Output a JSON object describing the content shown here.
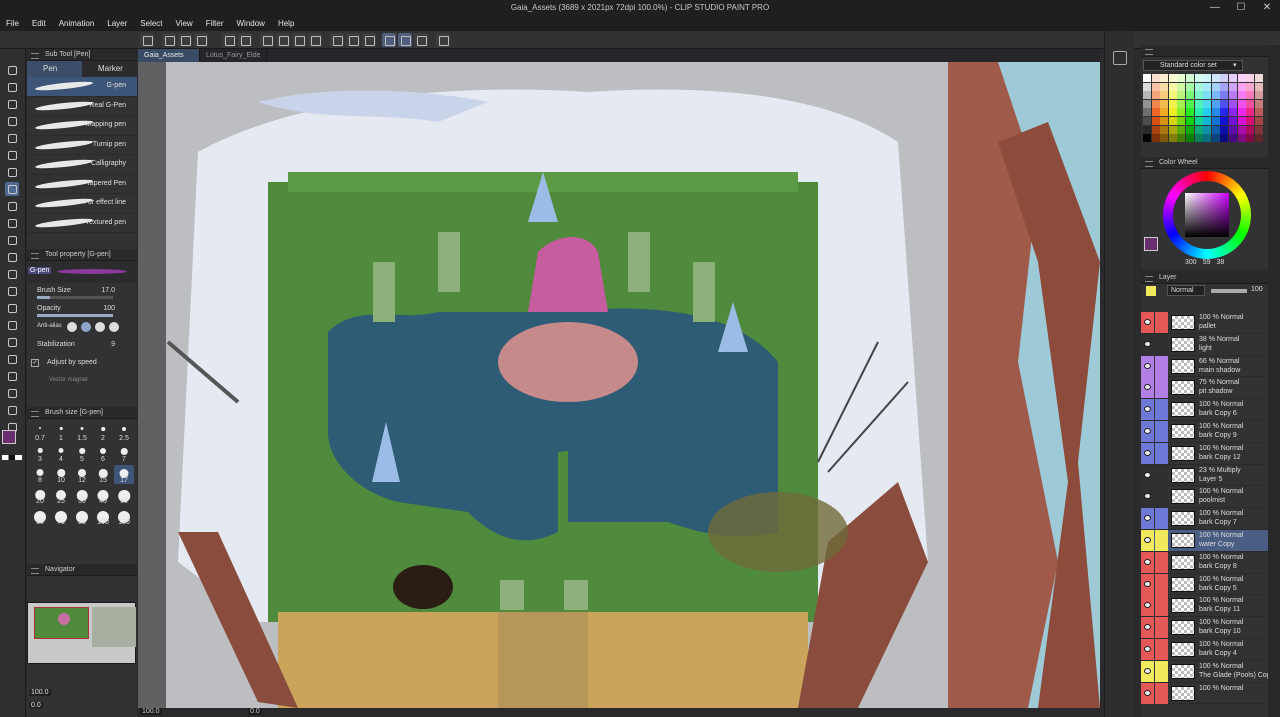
{
  "app": {
    "title": "Gaia_Assets (3689 x 2021px 72dpi 100.0%)  - CLIP STUDIO PAINT PRO"
  },
  "window_controls": {
    "minimize": "—",
    "maximize": "☐",
    "close": "✕"
  },
  "menu": [
    "File",
    "Edit",
    "Animation",
    "Layer",
    "Select",
    "View",
    "Filter",
    "Window",
    "Help"
  ],
  "tabs": [
    {
      "label": "Gaia_Assets",
      "active": true
    },
    {
      "label": "Lotus_Fairy_Elde",
      "active": false
    }
  ],
  "sub_tool": {
    "title": "Sub Tool [Pen]",
    "groups": [
      "Pen",
      "Marker"
    ],
    "brushes": [
      "G-pen",
      "Real G-Pen",
      "Mapping pen",
      "Turnip pen",
      "Calligraphy",
      "Tapered Pen",
      "For effect line",
      "Textured pen"
    ]
  },
  "tool_property": {
    "title": "Tool property [G-pen]",
    "preview_label": "G-pen",
    "brush_size_label": "Brush Size",
    "brush_size_value": "17.0",
    "brush_size_level": 0.17,
    "opacity_label": "Opacity",
    "opacity_value": "100",
    "opacity_level": 1.0,
    "antialias_label": "Anti-alias",
    "stabilization_label": "Stabilization",
    "stabilization_value": "9",
    "adjust_speed_label": "Adjust by speed",
    "vector_magnet_label": "Vector magnet"
  },
  "brush_size_panel": {
    "title": "Brush size [G-pen]",
    "sizes": [
      "0.7",
      "1",
      "1.5",
      "2",
      "2.5",
      "3",
      "4",
      "5",
      "6",
      "7",
      "8",
      "10",
      "12",
      "15",
      "17",
      "20",
      "25",
      "30",
      "40",
      "50",
      "60",
      "70",
      "80",
      "100",
      "120"
    ],
    "selected": "17"
  },
  "navigator": {
    "title": "Navigator",
    "zoom": "100.0",
    "rotation": "0.0"
  },
  "status": {
    "zoom": "100.0",
    "angle": "0.0"
  },
  "color_set": {
    "title": "Standard color set",
    "selected": "Standard color set"
  },
  "color_wheel": {
    "title": "Color Wheel",
    "values": [
      "300",
      "59",
      "38"
    ]
  },
  "colors": {
    "main": "#6a2f6e",
    "accent": "#4f6a92",
    "selected_layer": "#4a5e84"
  },
  "layer_panel": {
    "title": "Layer",
    "blend_mode": "Normal",
    "opacity": "100",
    "layers": [
      {
        "line1": "100 % Normal",
        "line2": "pallet",
        "tag": "#e45858"
      },
      {
        "line1": "38 % Normal",
        "line2": "light",
        "tag": "#2f2f32"
      },
      {
        "line1": "66 % Normal",
        "line2": "main shadow",
        "tag": "#b27fe6"
      },
      {
        "line1": "75 % Normal",
        "line2": "pit shadow",
        "tag": "#b27fe6"
      },
      {
        "line1": "100 % Normal",
        "line2": "bark Copy 6",
        "tag": "#6c79d6"
      },
      {
        "line1": "100 % Normal",
        "line2": "bark Copy 9",
        "tag": "#6c79d6"
      },
      {
        "line1": "100 % Normal",
        "line2": "bark Copy 12",
        "tag": "#6c79d6"
      },
      {
        "line1": "23 % Multiply",
        "line2": "Layer 5",
        "tag": "#2f2f32"
      },
      {
        "line1": "100 % Normal",
        "line2": "poolmist",
        "tag": "#2f2f32"
      },
      {
        "line1": "100 % Normal",
        "line2": "bark Copy 7",
        "tag": "#6c79d6"
      },
      {
        "line1": "100 % Normal",
        "line2": "water Copy",
        "tag": "#f1ea5c",
        "selected": true
      },
      {
        "line1": "100 % Normal",
        "line2": "bark Copy 8",
        "tag": "#e45858"
      },
      {
        "line1": "100 % Normal",
        "line2": "bark Copy 5",
        "tag": "#e45858"
      },
      {
        "line1": "100 % Normal",
        "line2": "bark Copy 11",
        "tag": "#e45858"
      },
      {
        "line1": "100 % Normal",
        "line2": "bark Copy 10",
        "tag": "#e45858"
      },
      {
        "line1": "100 % Normal",
        "line2": "bark Copy 4",
        "tag": "#e45858"
      },
      {
        "line1": "100 % Normal",
        "line2": "The Glade (Pools) Copy",
        "tag": "#f1ea5c"
      },
      {
        "line1": "100 % Normal",
        "line2": "",
        "tag": "#e45858"
      }
    ]
  }
}
